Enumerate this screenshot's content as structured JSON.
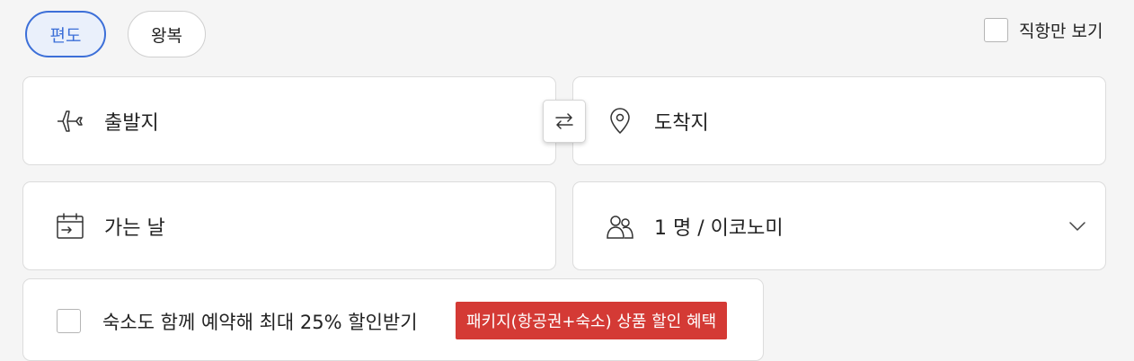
{
  "trip_type": {
    "one_way": "편도",
    "round_trip": "왕복",
    "selected": "one_way"
  },
  "direct_only": {
    "label": "직항만 보기",
    "checked": false
  },
  "search": {
    "origin_placeholder": "출발지",
    "destination_placeholder": "도착지",
    "date_placeholder": "가는 날",
    "passengers_class": "1 명 / 이코노미"
  },
  "hotel_bundle": {
    "label": "숙소도 함께 예약해 최대 25% 할인받기",
    "checked": false,
    "badge": "패키지(항공권+숙소) 상품 할인 혜택"
  },
  "colors": {
    "accent": "#3c6fd8",
    "accent_bg": "#eaf0fb",
    "promo_red": "#d43a35",
    "page_bg": "#f5f5f5"
  },
  "icons": {
    "origin": "airplane-icon",
    "swap": "swap-arrows-icon",
    "destination": "map-pin-icon",
    "date": "calendar-icon",
    "passengers": "people-icon",
    "dropdown": "chevron-down-icon"
  }
}
